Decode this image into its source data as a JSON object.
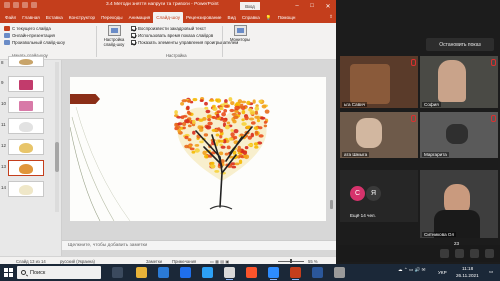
{
  "powerpoint": {
    "title": "3.4 Методи зняття напруги та тривоги - PowerPoint",
    "signin": "Вход",
    "quick_access": [
      "save-icon",
      "undo-icon",
      "redo-icon",
      "start-icon"
    ],
    "menu_tabs": [
      {
        "label": "Файл",
        "active": false
      },
      {
        "label": "Главная",
        "active": false
      },
      {
        "label": "Вставка",
        "active": false
      },
      {
        "label": "Конструктор",
        "active": false
      },
      {
        "label": "Переходы",
        "active": false
      },
      {
        "label": "Анимация",
        "active": false
      },
      {
        "label": "Слайд-шоу",
        "active": true
      },
      {
        "label": "Рецензирование",
        "active": false
      },
      {
        "label": "Вид",
        "active": false
      },
      {
        "label": "Справка",
        "active": false
      }
    ],
    "help": "Помощн",
    "ribbon": {
      "start": {
        "from_current": "С текущего слайда",
        "online": "Онлайн-презентация",
        "custom": "Произвольный слайд-шоу",
        "group_label": "Начать слайд-шоу"
      },
      "setup_button": "Настройка слайд-шоу",
      "setup_checks": [
        {
          "label": "Воспроизвести закадровый текст",
          "checked": true
        },
        {
          "label": "Использовать время показа слайдов",
          "checked": true
        },
        {
          "label": "Показать элементы управления проигрывателем",
          "checked": true
        }
      ],
      "setup_group_label": "Настройка",
      "monitors_button": "Мониторы"
    },
    "thumbnails": [
      {
        "num": "8"
      },
      {
        "num": "9"
      },
      {
        "num": "10"
      },
      {
        "num": "11"
      },
      {
        "num": "12"
      },
      {
        "num": "13",
        "selected": true
      },
      {
        "num": "14"
      }
    ],
    "notes_placeholder": "Щелкните, чтобы добавить заметки",
    "status": {
      "slide": "Слайд 13 из 14",
      "language": "русский (Украина)",
      "notes": "Заметки",
      "comments": "Примечания",
      "zoom": "55 %"
    }
  },
  "zoom": {
    "stop_button": "Остановить показ",
    "participants": [
      {
        "name": "ьга Савич"
      },
      {
        "name": "София"
      },
      {
        "name": "ата Шмыга"
      },
      {
        "name": "Маргарита"
      },
      {
        "name": "Ещё 14 чел."
      },
      {
        "name": "Ситникова Ол"
      }
    ],
    "avatars": [
      {
        "letter": "С",
        "color": "#d6336c"
      },
      {
        "letter": "Я",
        "color": "#3a3a3a"
      }
    ],
    "badge_count": "23"
  },
  "taskbar": {
    "search_placeholder": "Поиск",
    "lang": "УКР",
    "time": "11:18",
    "date": "26.11.2021"
  }
}
